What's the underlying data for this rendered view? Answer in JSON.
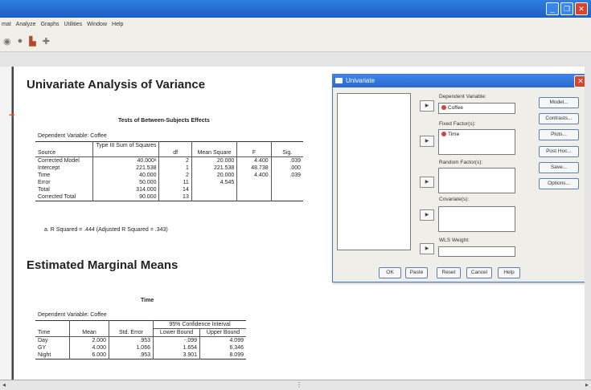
{
  "menu": [
    "mat",
    "Analyze",
    "Graphs",
    "Utilities",
    "Window",
    "Help"
  ],
  "toolbar_icons": [
    "dialog-recall-icon",
    "variables-icon",
    "chart-icon",
    "add-icon"
  ],
  "output": {
    "heading1": "Univariate Analysis of Variance",
    "table1": {
      "title": "Tests of Between-Subjects Effects",
      "dependent": "Dependent Variable: Coffee",
      "headers": [
        "Source",
        "Type III Sum of Squares",
        "df",
        "Mean Square",
        "F",
        "Sig."
      ],
      "rows": [
        [
          "Corrected Model",
          "40.000ᵃ",
          "2",
          "20.000",
          "4.400",
          ".039"
        ],
        [
          "Intercept",
          "221.538",
          "1",
          "221.538",
          "48.738",
          ".000"
        ],
        [
          "Time",
          "40.000",
          "2",
          "20.000",
          "4.400",
          ".039"
        ],
        [
          "Error",
          "50.000",
          "11",
          "4.545",
          "",
          ""
        ],
        [
          "Total",
          "314.000",
          "14",
          "",
          "",
          ""
        ],
        [
          "Corrected Total",
          "90.000",
          "13",
          "",
          "",
          ""
        ]
      ],
      "footnote": "a. R Squared = .444 (Adjusted R Squared = .343)"
    },
    "heading2": "Estimated Marginal Means",
    "table2": {
      "title": "Time",
      "dependent": "Dependent Variable: Coffee",
      "group_header": "95% Confidence Interval",
      "headers": [
        "Time",
        "Mean",
        "Std. Error",
        "Lower Bound",
        "Upper Bound"
      ],
      "rows": [
        [
          "Day",
          "2.000",
          ".953",
          "-.099",
          "4.099"
        ],
        [
          "GY",
          "4.000",
          "1.066",
          "1.654",
          "6.346"
        ],
        [
          "Night",
          "6.000",
          ".953",
          "3.901",
          "8.099"
        ]
      ]
    }
  },
  "dialog": {
    "title": "Univariate",
    "dependent_label": "Dependent Variable:",
    "dependent_value": "Coffee",
    "fixed_label": "Fixed Factor(s):",
    "fixed_value": "Time",
    "random_label": "Random Factor(s):",
    "covariate_label": "Covariate(s):",
    "wls_label": "WLS Weight:",
    "side_buttons": [
      "Model...",
      "Contrasts...",
      "Plots...",
      "Post Hoc...",
      "Save...",
      "Options..."
    ],
    "bottom_buttons": [
      "OK",
      "Paste",
      "Reset",
      "Cancel",
      "Help"
    ]
  }
}
